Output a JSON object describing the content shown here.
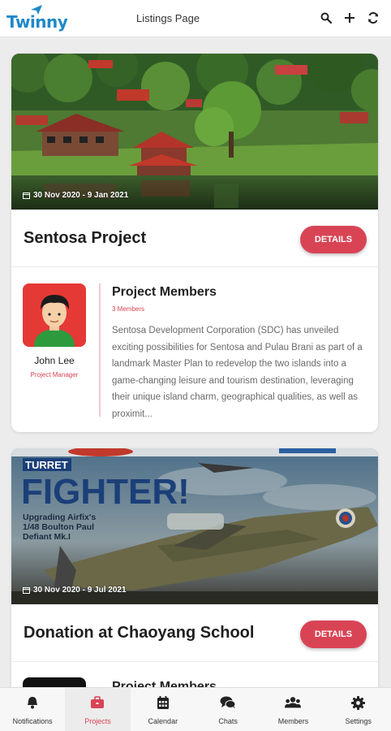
{
  "header": {
    "logo_text": "Twinny",
    "title": "Listings Page",
    "icons": [
      "search-icon",
      "plus-icon",
      "refresh-icon"
    ]
  },
  "colors": {
    "accent": "#d94455",
    "brand": "#1e88c9",
    "nav_background": "#f7f7f7"
  },
  "listings": [
    {
      "date_range": "30 Nov 2020 - 9 Jan 2021",
      "title": "Sentosa Project",
      "details_label": "DETAILS",
      "member_name": "John Lee",
      "member_role": "Project Manager",
      "members_heading": "Project Members",
      "members_count": "3 Members",
      "description": "Sentosa Development Corporation (SDC) has unveiled exciting possibilities for Sentosa and Pulau Brani as part of a landmark Master Plan to redevelop the two islands into a game-changing leisure and tourism destination, leveraging their unique island charm, geographical qualities, as well as proximit..."
    },
    {
      "date_range": "30 Nov 2020 - 9 Jul 2021",
      "title": "Donation at Chaoyang School",
      "details_label": "DETAILS",
      "members_heading": "Project Members",
      "image_text": {
        "line1": "TURRET",
        "line2": "FIGHTER!",
        "line3": "Upgrading Airfix's",
        "line4": "1/48 Boulton Paul",
        "line5": "Defiant Mk.I"
      }
    }
  ],
  "nav": {
    "active": "Projects",
    "items": [
      {
        "label": "Notifications",
        "icon": "bell-icon"
      },
      {
        "label": "Projects",
        "icon": "briefcase-icon"
      },
      {
        "label": "Calendar",
        "icon": "calendar-icon"
      },
      {
        "label": "Chats",
        "icon": "chat-icon"
      },
      {
        "label": "Members",
        "icon": "members-icon"
      },
      {
        "label": "Settings",
        "icon": "gear-icon"
      }
    ]
  }
}
